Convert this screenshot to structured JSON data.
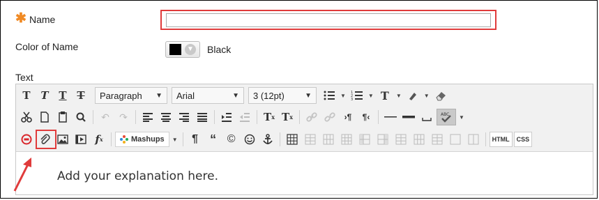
{
  "name_field": {
    "label": "Name",
    "required_marker": "✱",
    "value": ""
  },
  "color_field": {
    "label": "Color of Name",
    "selected": "Black",
    "swatch_color": "#000000"
  },
  "text_field": {
    "label": "Text"
  },
  "editor": {
    "format_select": "Paragraph",
    "font_select": "Arial",
    "size_select": "3 (12pt)",
    "mashups_label": "Mashups",
    "html_label": "HTML",
    "css_label": "CSS",
    "content": "Add your explanation here."
  },
  "highlight_color": "#e03b3b",
  "accent_star_color": "#f08a24"
}
